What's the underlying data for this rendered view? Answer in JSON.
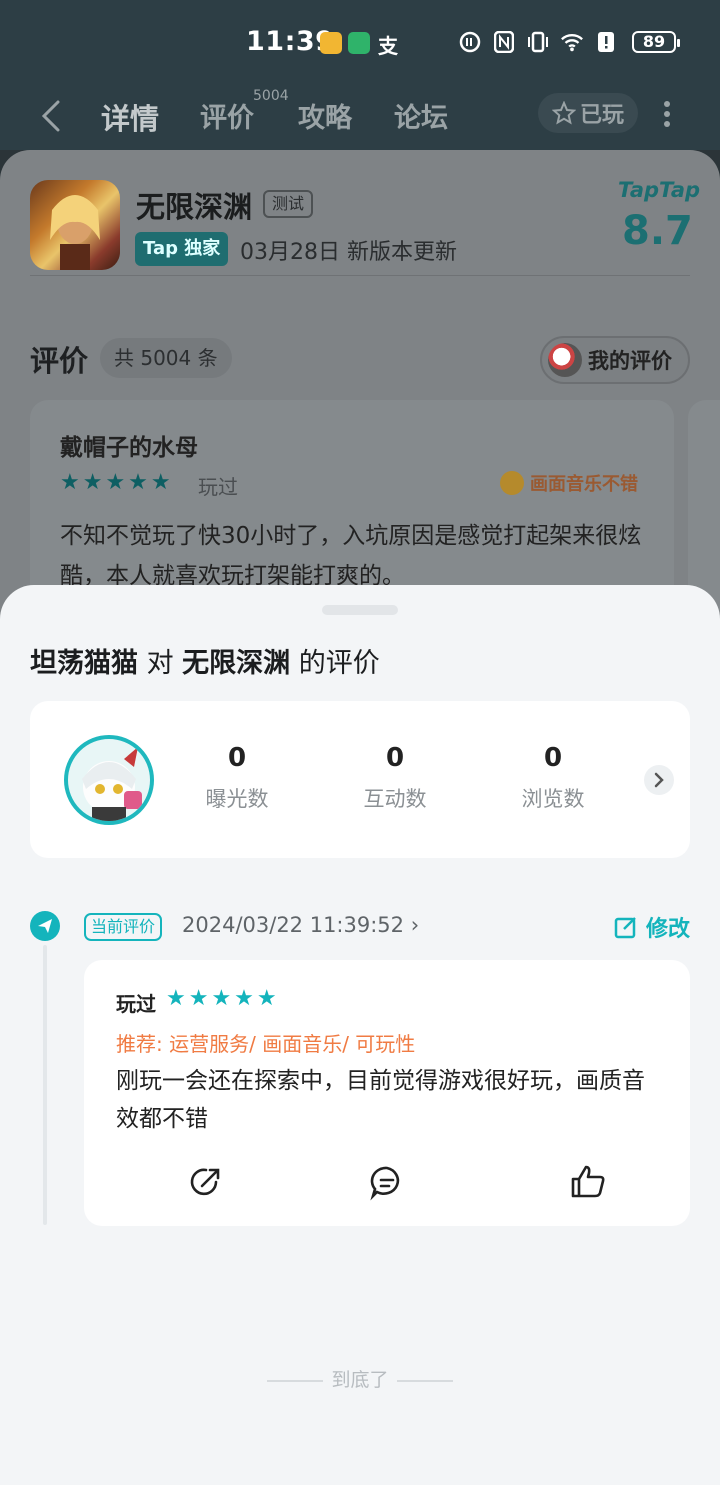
{
  "status_bar": {
    "time": "11:39",
    "battery": "89",
    "pay_glyph": "支"
  },
  "nav": {
    "tabs": [
      "详情",
      "评价",
      "攻略",
      "论坛"
    ],
    "active_tab": "详情",
    "review_badge": "5004",
    "played_label": "已玩"
  },
  "game": {
    "name": "无限深渊",
    "test_tag": "测试",
    "exclusive_tag": "Tap 独家",
    "update_text": "03月28日 新版本更新",
    "brand": "TapTap",
    "score": "8.7"
  },
  "reviews_section": {
    "title": "评价",
    "count_label": "共 5004 条",
    "my_review_label": "我的评价"
  },
  "background_review": {
    "username": "戴帽子的水母",
    "stars": "★★★★★",
    "status": "玩过",
    "tag": "画面音乐不错",
    "text": "不知不觉玩了快30小时了，入坑原因是感觉打起架来很炫酷，本人就喜欢玩打架能打爽的。"
  },
  "sheet": {
    "user": "坦荡猫猫",
    "connector": " 对 ",
    "game": "无限深渊",
    "suffix": " 的评价",
    "stats": [
      {
        "value": "0",
        "label": "曝光数"
      },
      {
        "value": "0",
        "label": "互动数"
      },
      {
        "value": "0",
        "label": "浏览数"
      }
    ],
    "current_tag": "当前评价",
    "date": "2024/03/22 11:39:52",
    "edit_label": "修改",
    "review": {
      "status": "玩过",
      "stars": "★★★★★",
      "recommend": "推荐: 运营服务/ 画面音乐/ 可玩性",
      "body": "刚玩一会还在探索中，目前觉得游戏很好玩，画质音效都不错"
    },
    "end_text": "到底了"
  },
  "colors": {
    "accent": "#14b4bc",
    "recommend": "#f07b43",
    "overlay_header": "#2d3e45"
  }
}
